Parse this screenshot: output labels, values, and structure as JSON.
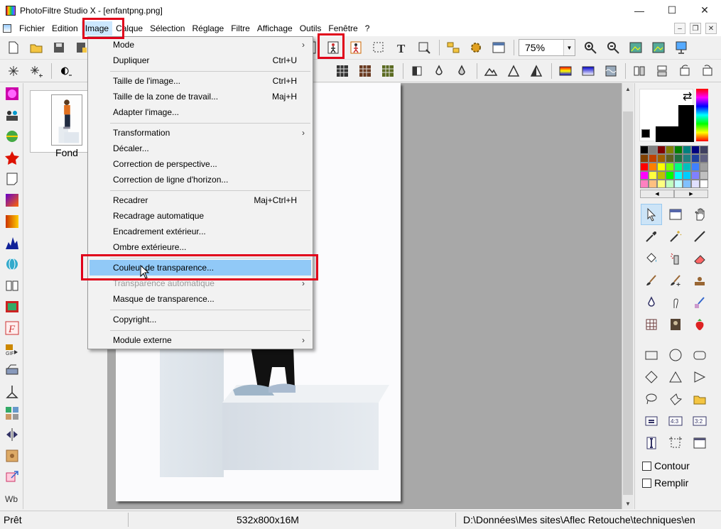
{
  "window": {
    "title": "PhotoFiltre Studio X - [enfantpng.png]",
    "minimize": "—",
    "maximize": "☐",
    "close": "✕"
  },
  "menubar": {
    "items": [
      "Fichier",
      "Edition",
      "Image",
      "Calque",
      "Sélection",
      "Réglage",
      "Filtre",
      "Affichage",
      "Outils",
      "Fenêtre",
      "?"
    ],
    "active": "Image"
  },
  "toolbar": {
    "zoom": "75%"
  },
  "layers": {
    "items": [
      {
        "name": "Fond"
      }
    ]
  },
  "image_menu": {
    "items": [
      {
        "label": "Mode",
        "shortcut": "",
        "submenu": true
      },
      {
        "label": "Dupliquer",
        "shortcut": "Ctrl+U"
      },
      {
        "label": "Taille de l'image...",
        "shortcut": "Ctrl+H"
      },
      {
        "label": "Taille de la zone de travail...",
        "shortcut": "Maj+H"
      },
      {
        "label": "Adapter l'image...",
        "shortcut": ""
      },
      {
        "label": "Transformation",
        "shortcut": "",
        "submenu": true
      },
      {
        "label": "Décaler...",
        "shortcut": ""
      },
      {
        "label": "Correction de perspective...",
        "shortcut": ""
      },
      {
        "label": "Correction de ligne d'horizon...",
        "shortcut": ""
      },
      {
        "label": "Recadrer",
        "shortcut": "Maj+Ctrl+H"
      },
      {
        "label": "Recadrage automatique",
        "shortcut": ""
      },
      {
        "label": "Encadrement extérieur...",
        "shortcut": ""
      },
      {
        "label": "Ombre extérieure...",
        "shortcut": ""
      },
      {
        "label": "Couleur de transparence...",
        "shortcut": "",
        "highlighted": true
      },
      {
        "label": "Transparence automatique",
        "shortcut": "",
        "submenu": true,
        "disabled": true
      },
      {
        "label": "Masque de transparence...",
        "shortcut": ""
      },
      {
        "label": "Copyright...",
        "shortcut": ""
      },
      {
        "label": "Module externe",
        "shortcut": "",
        "submenu": true
      }
    ]
  },
  "right_panel": {
    "contour_label": "Contour",
    "remplir_label": "Remplir",
    "palette": [
      "#000000",
      "#808080",
      "#800000",
      "#808000",
      "#008000",
      "#008080",
      "#000080",
      "#404060",
      "#804000",
      "#c04000",
      "#a06000",
      "#606020",
      "#207040",
      "#208080",
      "#2040a0",
      "#606080",
      "#ff0000",
      "#ff8000",
      "#ffff00",
      "#80ff00",
      "#00ff80",
      "#00c0c0",
      "#4080ff",
      "#a0a0a0",
      "#ff00ff",
      "#ffff40",
      "#c0c000",
      "#00ff00",
      "#00ffff",
      "#00ccff",
      "#8080ff",
      "#c0c0c0",
      "#ff80c0",
      "#ffc080",
      "#ffff80",
      "#c0ffc0",
      "#c0ffff",
      "#80c0ff",
      "#e0e0ff",
      "#ffffff"
    ]
  },
  "statusbar": {
    "state": "Prêt",
    "dimensions": "532x800x16M",
    "path": "D:\\Données\\Mes sites\\Aflec Retouche\\techniques\\en"
  },
  "colors": {
    "highlight_red": "#e0001a",
    "menu_highlight": "#91c9f7"
  }
}
